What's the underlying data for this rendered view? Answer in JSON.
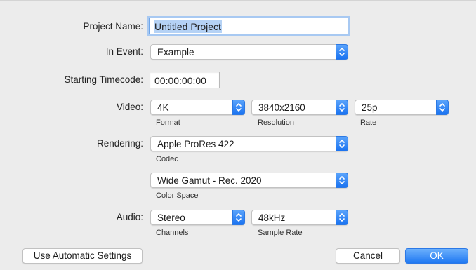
{
  "project_name": {
    "label": "Project Name:",
    "value": "Untitled Project"
  },
  "in_event": {
    "label": "In Event:",
    "value": "Example"
  },
  "starting_timecode": {
    "label": "Starting Timecode:",
    "value": "00:00:00:00"
  },
  "video": {
    "label": "Video:",
    "format": {
      "value": "4K",
      "caption": "Format"
    },
    "resolution": {
      "value": "3840x2160",
      "caption": "Resolution"
    },
    "rate": {
      "value": "25p",
      "caption": "Rate"
    }
  },
  "rendering": {
    "label": "Rendering:",
    "codec": {
      "value": "Apple ProRes 422",
      "caption": "Codec"
    },
    "color_space": {
      "value": "Wide Gamut - Rec. 2020",
      "caption": "Color Space"
    }
  },
  "audio": {
    "label": "Audio:",
    "channels": {
      "value": "Stereo",
      "caption": "Channels"
    },
    "sample_rate": {
      "value": "48kHz",
      "caption": "Sample Rate"
    }
  },
  "buttons": {
    "automatic": "Use Automatic Settings",
    "cancel": "Cancel",
    "ok": "OK"
  },
  "colors": {
    "accent": "#1f78f2",
    "focus_ring": "#a8c9f2",
    "background": "#ececec"
  },
  "icons": {
    "popup_stepper": "updown-chevron-icon"
  }
}
